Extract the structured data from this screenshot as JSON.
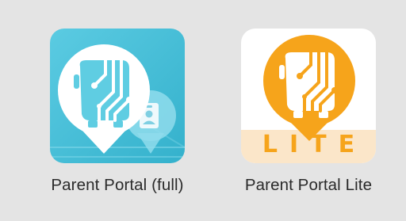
{
  "apps": [
    {
      "label": "Parent Portal (full)",
      "icon": "bus-location-pin-icon",
      "colors": {
        "background": "#4cc4dc",
        "background_dark": "#32acc9",
        "pin": "#ffffff",
        "bus": "#5fcde2",
        "circuit": "#ffffff",
        "id_card": "#e9f7fb"
      }
    },
    {
      "label": "Parent Portal Lite",
      "icon": "bus-location-pin-icon",
      "badge_text": "LITE",
      "colors": {
        "background": "#ffffff",
        "pin": "#f6a41b",
        "bus": "#ffffff",
        "circuit": "#f6a41b",
        "badge_band": "#fbe6c9",
        "badge_text": "#f6a41b"
      }
    }
  ]
}
